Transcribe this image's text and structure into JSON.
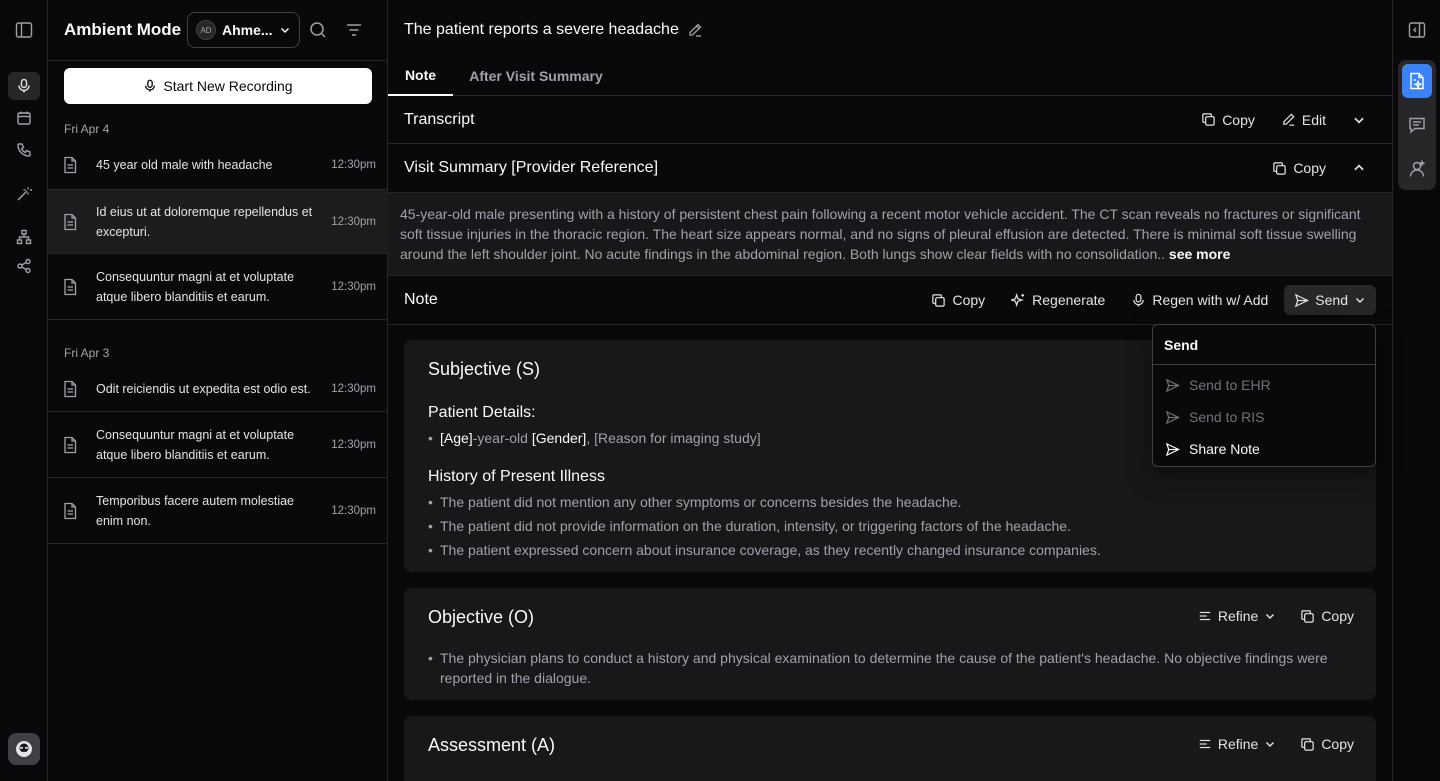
{
  "app": {
    "title": "Ambient Mode"
  },
  "user": {
    "initials": "AD",
    "name": "Ahme..."
  },
  "sidebar": {
    "record_label": "Start New Recording",
    "groups": [
      {
        "date": "Fri Apr 4",
        "items": [
          {
            "title": "45 year old male with headache",
            "time": "12:30pm"
          },
          {
            "title": "Id eius ut at doloremque repellendus et excepturi.",
            "time": "12:30pm"
          },
          {
            "title": "Consequuntur magni at et voluptate atque libero blanditiis et earum.",
            "time": "12:30pm"
          }
        ]
      },
      {
        "date": "Fri Apr 3",
        "items": [
          {
            "title": "Odit reiciendis ut expedita est odio est.",
            "time": "12:30pm"
          },
          {
            "title": "Consequuntur magni at et voluptate atque libero blanditiis et earum.",
            "time": "12:30pm"
          },
          {
            "title": "Temporibus facere autem molestiae enim non.",
            "time": "12:30pm"
          }
        ]
      }
    ]
  },
  "main": {
    "title": "The patient reports a severe headache",
    "tabs": [
      {
        "label": "Note"
      },
      {
        "label": "After Visit Summary"
      }
    ],
    "transcript": {
      "label": "Transcript",
      "copy": "Copy",
      "edit": "Edit"
    },
    "visit_summary": {
      "label": "Visit Summary [Provider Reference]",
      "copy": "Copy",
      "text": "45-year-old male presenting with a history of persistent chest pain following a recent motor vehicle accident. The CT scan reveals no fractures or significant soft tissue injuries in the thoracic region. The heart size appears normal, and no signs of pleural effusion are detected. There is minimal soft tissue swelling around the left shoulder joint. No acute findings in the abdominal region. Both lungs show clear fields with no consolidation..",
      "more": "see more"
    },
    "note_bar": {
      "label": "Note",
      "copy": "Copy",
      "regenerate": "Regenerate",
      "regen_add": "Regen with w/ Add",
      "send": "Send"
    },
    "subjective": {
      "title": "Subjective (S)",
      "details_heading": "Patient Details:",
      "detail_age": "[Age]",
      "detail_mid": "-year-old ",
      "detail_gender": "[Gender]",
      "detail_rest": ", [Reason for imaging study]",
      "hpi_heading": "History of Present Illness",
      "hpi": [
        "The patient did not mention any other symptoms or concerns besides the headache.",
        "The patient did not provide information on the duration, intensity, or triggering factors of the headache.",
        "The patient expressed concern about insurance coverage, as they recently changed insurance companies."
      ]
    },
    "objective": {
      "title": "Objective (O)",
      "refine": "Refine",
      "copy": "Copy",
      "bullets": [
        "The physician plans to conduct a history and physical examination to determine the cause of the patient's headache. No objective findings were reported in the dialogue."
      ]
    },
    "assessment": {
      "title": "Assessment (A)",
      "refine": "Refine",
      "copy": "Copy"
    }
  },
  "send_menu": {
    "title": "Send",
    "items": [
      {
        "label": "Send to EHR",
        "enabled": false
      },
      {
        "label": "Send to RIS",
        "enabled": false
      },
      {
        "label": "Share Note",
        "enabled": true
      }
    ]
  },
  "colors": {
    "accent": "#3b82f6",
    "background": "#09090b",
    "card": "#18181b",
    "border": "#27272a"
  }
}
